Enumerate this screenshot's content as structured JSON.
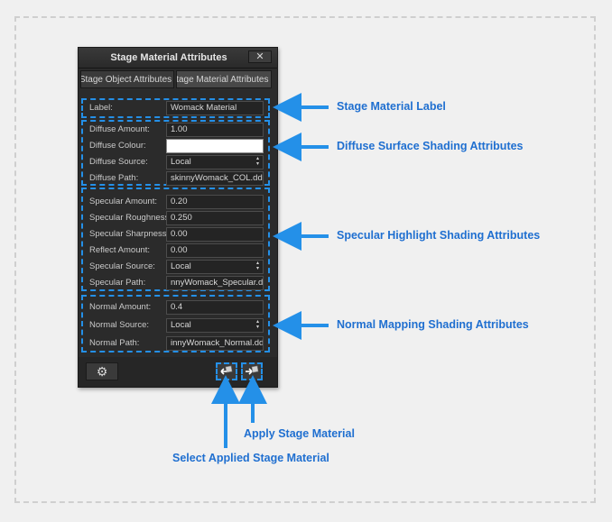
{
  "window": {
    "title": "Stage Material Attributes",
    "close_label": "✕",
    "tabs": [
      {
        "label": "Stage Object Attributes"
      },
      {
        "label": "Stage Material Attributes"
      }
    ]
  },
  "label_group": {
    "label": "Label:",
    "value": "Womack Material"
  },
  "diffuse": {
    "amount_label": "Diffuse Amount:",
    "amount_value": "1.00",
    "colour_label": "Diffuse Colour:",
    "colour_value": "#ffffff",
    "source_label": "Diffuse Source:",
    "source_value": "Local",
    "path_label": "Diffuse Path:",
    "path_value": "skinnyWomack_COL.dds"
  },
  "specular": {
    "amount_label": "Specular Amount:",
    "amount_value": "0.20",
    "roughness_label": "Specular Roughness:",
    "roughness_value": "0.250",
    "sharpness_label": "Specular Sharpness:",
    "sharpness_value": "0.00",
    "reflect_label": "Reflect Amount:",
    "reflect_value": "0.00",
    "source_label": "Specular Source:",
    "source_value": "Local",
    "path_label": "Specular Path:",
    "path_value": "nnyWomack_Specular.dds"
  },
  "normal": {
    "amount_label": "Normal Amount:",
    "amount_value": "0.4",
    "source_label": "Normal Source:",
    "source_value": "Local",
    "path_label": "Normal Path:",
    "path_value": "innyWomack_Normal.dds"
  },
  "toolbar": {
    "settings_icon": "gear-icon",
    "select_icon": "select-material-icon",
    "apply_icon": "apply-material-icon"
  },
  "callouts": {
    "label": "Stage Material Label",
    "diffuse": "Diffuse Surface Shading Attributes",
    "specular": "Specular Highlight Shading Attributes",
    "normal": "Normal Mapping Shading Attributes",
    "apply": "Apply Stage Material",
    "select": "Select Applied Stage Material"
  },
  "colors": {
    "accent": "#2490e8",
    "callout_text": "#1f6fd0",
    "panel_bg": "#2b2b2b"
  }
}
